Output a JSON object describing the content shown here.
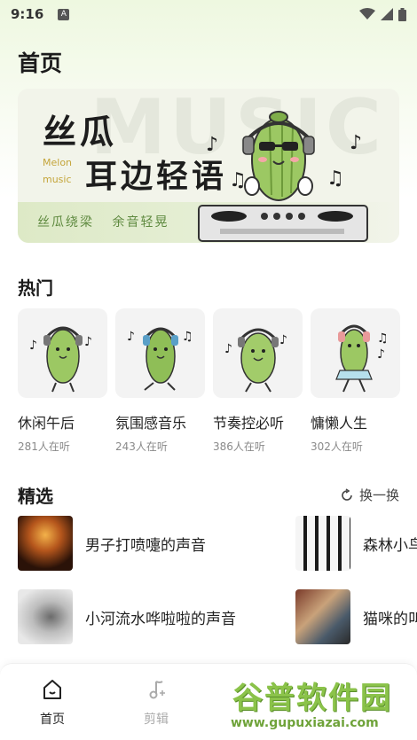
{
  "status_bar": {
    "time": "9:16",
    "notif_icon": "A"
  },
  "header": {
    "title": "首页"
  },
  "banner": {
    "title_line1": "丝瓜",
    "title_line2": "耳边轻语",
    "brand_line1": "Melon",
    "brand_line2": "music",
    "watermark": "MUSIC",
    "slogan_left": "丝瓜绕梁",
    "slogan_right": "余音轻晃"
  },
  "hot": {
    "title": "热门",
    "items": [
      {
        "name": "休闲午后",
        "count": "281人在听"
      },
      {
        "name": "氛围感音乐",
        "count": "243人在听"
      },
      {
        "name": "节奏控必听",
        "count": "386人在听"
      },
      {
        "name": "慵懒人生",
        "count": "302人在听"
      }
    ]
  },
  "picks": {
    "title": "精选",
    "refresh_label": "换一换",
    "items": [
      {
        "label": "男子打喷嚏的声音"
      },
      {
        "label": "森林小鸟"
      },
      {
        "label": "小河流水哗啦啦的声音"
      },
      {
        "label": "猫咪的叫"
      }
    ]
  },
  "tabbar": {
    "home_label": "首页",
    "edit_label": "剪辑",
    "active_color": "#222222",
    "inactive_color": "#aaaaaa"
  },
  "watermark_logo": {
    "text": "谷普软件园",
    "url": "www.gupuxiazai.com"
  },
  "colors": {
    "accent_green": "#5f8a40",
    "bg_gradient_top": "#eef8e0"
  }
}
